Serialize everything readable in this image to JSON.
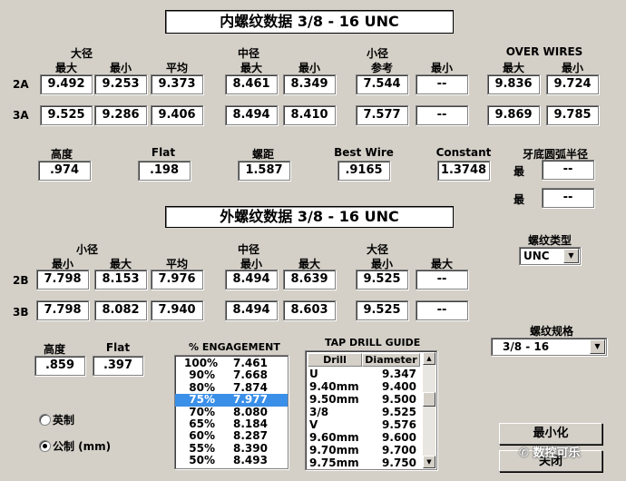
{
  "internal": {
    "title": "内螺纹数据   3/8 - 16  UNC",
    "groups": {
      "major": "大径",
      "pitch": "中径",
      "minor": "小径",
      "over_wires": "OVER WIRES"
    },
    "sub": {
      "max": "最大",
      "min": "最小",
      "avg": "平均",
      "ref": "参考"
    },
    "rows": [
      {
        "label": "2A",
        "values": [
          "9.492",
          "9.253",
          "9.373",
          "8.461",
          "8.349",
          "7.544",
          "--",
          "9.836",
          "9.724"
        ]
      },
      {
        "label": "3A",
        "values": [
          "9.525",
          "9.286",
          "9.406",
          "8.494",
          "8.410",
          "7.577",
          "--",
          "9.869",
          "9.785"
        ]
      }
    ],
    "params": [
      {
        "label": "高度",
        "value": ".974"
      },
      {
        "label": "Flat",
        "value": ".198"
      },
      {
        "label": "螺距",
        "value": "1.587"
      },
      {
        "label": "Best Wire",
        "value": ".9165"
      },
      {
        "label": "Constant",
        "value": "1.3748"
      }
    ],
    "root_radius": {
      "label": "牙底圆弧半径",
      "rows": [
        {
          "label": "最",
          "value": "--"
        },
        {
          "label": "最",
          "value": "--"
        }
      ]
    }
  },
  "external": {
    "title": "外螺纹数据   3/8 - 16  UNC",
    "groups": {
      "minor": "小径",
      "pitch": "中径",
      "major": "大径"
    },
    "sub": {
      "min": "最小",
      "max": "最大",
      "avg": "平均"
    },
    "rows": [
      {
        "label": "2B",
        "values": [
          "7.798",
          "8.153",
          "7.976",
          "8.494",
          "8.639",
          "9.525",
          "--"
        ]
      },
      {
        "label": "3B",
        "values": [
          "7.798",
          "8.082",
          "7.940",
          "8.494",
          "8.603",
          "9.525",
          "--"
        ]
      }
    ],
    "params": [
      {
        "label": "高度",
        "value": ".859"
      },
      {
        "label": "Flat",
        "value": ".397"
      }
    ]
  },
  "thread_type": {
    "label": "螺纹类型",
    "value": "UNC"
  },
  "thread_spec": {
    "label": "螺纹规格",
    "value": "3/8 - 16"
  },
  "engagement": {
    "title": "% ENGAGEMENT",
    "selected_index": 3,
    "items": [
      {
        "pct": "100%",
        "drill": "7.461"
      },
      {
        "pct": "90%",
        "drill": "7.668"
      },
      {
        "pct": "80%",
        "drill": "7.874"
      },
      {
        "pct": "75%",
        "drill": "7.977"
      },
      {
        "pct": "70%",
        "drill": "8.080"
      },
      {
        "pct": "65%",
        "drill": "8.184"
      },
      {
        "pct": "60%",
        "drill": "8.287"
      },
      {
        "pct": "55%",
        "drill": "8.390"
      },
      {
        "pct": "50%",
        "drill": "8.493"
      }
    ]
  },
  "tap_drill": {
    "title": "TAP DRILL GUIDE",
    "col_drill": "Drill",
    "col_diameter": "Diameter",
    "rows": [
      {
        "drill": "U",
        "diameter": "9.347"
      },
      {
        "drill": "9.40mm",
        "diameter": "9.400"
      },
      {
        "drill": "9.50mm",
        "diameter": "9.500"
      },
      {
        "drill": "3/8",
        "diameter": "9.525"
      },
      {
        "drill": "V",
        "diameter": "9.576"
      },
      {
        "drill": "9.60mm",
        "diameter": "9.600"
      },
      {
        "drill": "9.70mm",
        "diameter": "9.700"
      },
      {
        "drill": "9.75mm",
        "diameter": "9.750"
      }
    ]
  },
  "units": {
    "imperial": "英制",
    "metric": "公制 (mm)",
    "selected": "metric"
  },
  "buttons": {
    "minimize": "最小化",
    "close": "关闭"
  },
  "watermark": "数控可乐"
}
